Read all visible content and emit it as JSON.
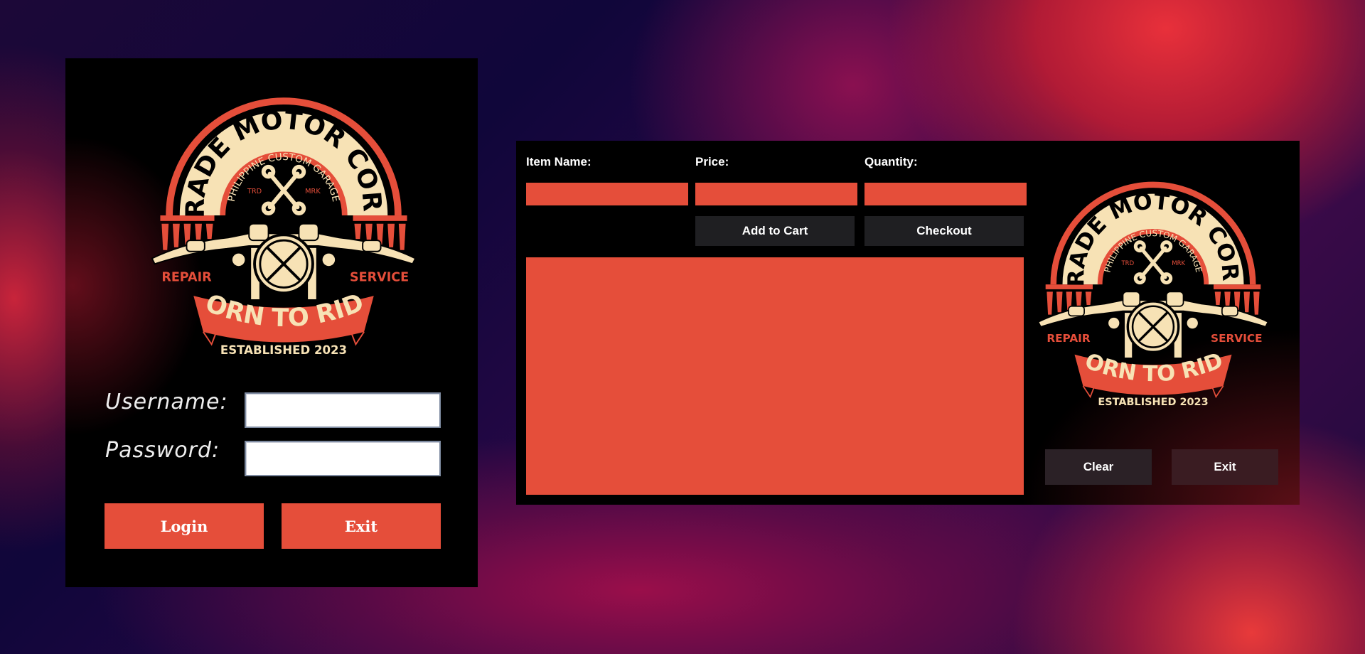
{
  "logo": {
    "brand": "TRADE MOTOR CORP.",
    "subtitle": "PHILIPPINE CUSTOM GARAGE",
    "mark_left": "TRD",
    "mark_right": "MRK",
    "left_word": "REPAIR",
    "right_word": "SERVICE",
    "banner": "BORN TO RIDE",
    "established": "ESTABLISHED 2023"
  },
  "colors": {
    "accent": "#e54e3a",
    "cream": "#f7e2b5",
    "panel": "#000000"
  },
  "login": {
    "username_label": "Username:",
    "password_label": "Password:",
    "username_value": "",
    "password_value": "",
    "login_label": "Login",
    "exit_label": "Exit"
  },
  "cart": {
    "item_name_label": "Item Name:",
    "price_label": "Price:",
    "quantity_label": "Quantity:",
    "item_name_value": "",
    "price_value": "",
    "quantity_value": "",
    "add_to_cart_label": "Add to Cart",
    "checkout_label": "Checkout",
    "cart_contents": "",
    "clear_label": "Clear",
    "exit_label": "Exit"
  }
}
